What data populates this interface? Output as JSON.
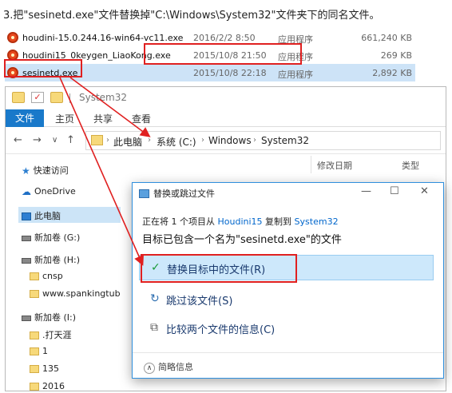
{
  "instruction": "3.把\"sesinetd.exe\"文件替换掉\"C:\\Windows\\System32\"文件夹下的同名文件。",
  "files": [
    {
      "name": "houdini-15.0.244.16-win64-vc11.exe",
      "date": "2016/2/2 8:50",
      "type": "应用程序",
      "size": "661,240 KB"
    },
    {
      "name": "houdini15_0keygen_LiaoKong.exe",
      "date": "2015/10/8 21:50",
      "type": "应用程序",
      "size": "269 KB"
    },
    {
      "name": "sesinetd.exe",
      "date": "2015/10/8 22:18",
      "type": "应用程序",
      "size": "2,892 KB"
    }
  ],
  "explorer": {
    "title": "System32",
    "tabs": {
      "file": "文件",
      "home": "主页",
      "share": "共享",
      "view": "查看"
    },
    "path": {
      "root": "此电脑",
      "drive": "系统 (C:)",
      "windows": "Windows",
      "system32": "System32"
    },
    "nav": {
      "quick": "快速访问",
      "onedrive": "OneDrive",
      "pc": "此电脑",
      "vol_g": "新加卷 (G:)",
      "vol_h": "新加卷 (H:)",
      "cnsp": "cnsp",
      "spank": "www.spankingtub",
      "vol_i": "新加卷 (I:)",
      "tianya": ".打天涯",
      "one": "1",
      "n135": "135",
      "n2016": "2016"
    },
    "columns": {
      "date": "修改日期",
      "type": "类型"
    }
  },
  "dialog": {
    "title": "替换或跳过文件",
    "status_prefix": "正在将 1 个项目从 ",
    "source": "Houdini15",
    "status_mid": " 复制到 ",
    "dest": "System32",
    "heading": "目标已包含一个名为\"sesinetd.exe\"的文件",
    "replace": "替换目标中的文件(R)",
    "skip": "跳过该文件(S)",
    "compare": "比较两个文件的信息(C)",
    "details": "简略信息"
  },
  "colors": {
    "accent": "#1979ca",
    "highlight_border": "#e02020",
    "selection": "#cde3f7"
  }
}
